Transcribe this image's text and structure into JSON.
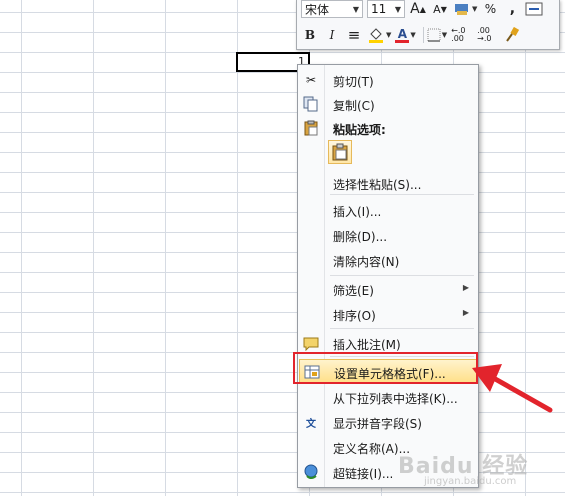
{
  "sheet": {
    "active_cell_value": "1"
  },
  "mini_toolbar": {
    "font_name": "宋体",
    "font_size": "11",
    "grow_font_icon": "A",
    "shrink_font_icon": "A",
    "percent": "%",
    "comma": ",",
    "bold": "B",
    "italic": "I",
    "align": "≡",
    "font_color_letter": "A",
    "inc_decimal": "←.0 .00",
    "dec_decimal": ".00 →.0"
  },
  "context_menu": {
    "items": [
      {
        "label": "剪切(T)",
        "icon": "scissors-icon"
      },
      {
        "label": "复制(C)",
        "icon": "copy-icon"
      },
      {
        "label": "粘贴选项:",
        "icon": "clipboard-icon"
      },
      {
        "label": "选择性粘贴(S)...",
        "icon": ""
      },
      {
        "label": "插入(I)...",
        "icon": ""
      },
      {
        "label": "删除(D)...",
        "icon": ""
      },
      {
        "label": "清除内容(N)",
        "icon": ""
      },
      {
        "label": "筛选(E)",
        "icon": "",
        "submenu": true
      },
      {
        "label": "排序(O)",
        "icon": "",
        "submenu": true
      },
      {
        "label": "插入批注(M)",
        "icon": "note-icon"
      },
      {
        "label": "设置单元格格式(F)...",
        "icon": "format-cells-icon",
        "selected": true
      },
      {
        "label": "从下拉列表中选择(K)...",
        "icon": ""
      },
      {
        "label": "显示拼音字段(S)",
        "icon": "phonetic-icon"
      },
      {
        "label": "定义名称(A)...",
        "icon": ""
      },
      {
        "label": "超链接(I)...",
        "icon": "hyperlink-icon"
      }
    ]
  },
  "watermark": {
    "text": "Baidu 经验",
    "sub": "jingyan.baidu.com"
  },
  "colors": {
    "highlight_border": "#e2242c",
    "arrow": "#e2242c",
    "font_color_bar": "#e2242c",
    "fill_color_bar": "#ffd200"
  }
}
